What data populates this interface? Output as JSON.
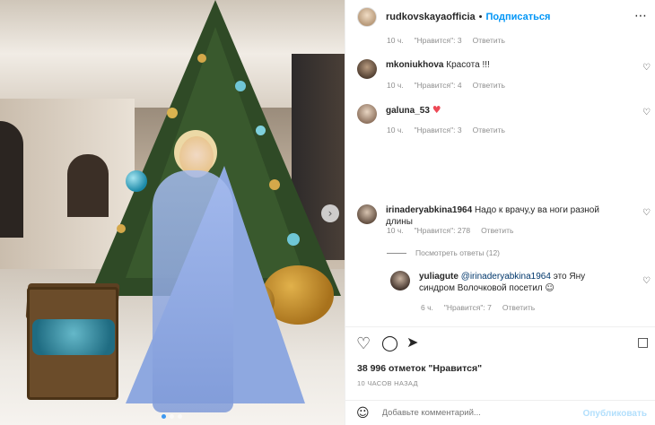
{
  "post": {
    "username": "rudkovskayaofficia",
    "follow_label": "Подписаться",
    "more_icon": "more-horizontal-icon"
  },
  "comments": [
    {
      "user": "",
      "text": "",
      "time": "10 ч.",
      "likes": "\"Нравится\": 3",
      "reply": "Ответить"
    },
    {
      "user": "mkoniukhova",
      "text": "Красота !!!",
      "time": "10 ч.",
      "likes": "\"Нравится\": 4",
      "reply": "Ответить"
    },
    {
      "user": "galuna_53",
      "text": "",
      "time": "10 ч.",
      "likes": "\"Нравится\": 3",
      "reply": "Ответить"
    },
    {
      "user": "irinaderyabkina1964",
      "text": "Надо к врачу,у ва ноги разной длины",
      "time": "10 ч.",
      "likes": "\"Нравится\": 278",
      "reply": "Ответить"
    }
  ],
  "view_replies": "Посмотреть ответы (12)",
  "reply": {
    "user": "yuliagute",
    "mention": "@irinaderyabkina1964",
    "text": "это Яну синдром Волочковой посетил",
    "time": "6 ч.",
    "likes": "\"Нравится\": 7",
    "reply": "Ответить"
  },
  "likes_count": "38 996 отметок \"Нравится\"",
  "posted_time": "10 часов назад",
  "comment_box": {
    "placeholder": "Добавьте комментарий...",
    "publish_label": "Опубликовать"
  },
  "colors": {
    "accent": "#0095f6",
    "publish_disabled": "#b2dffc",
    "heart_red": "#ed4956"
  }
}
